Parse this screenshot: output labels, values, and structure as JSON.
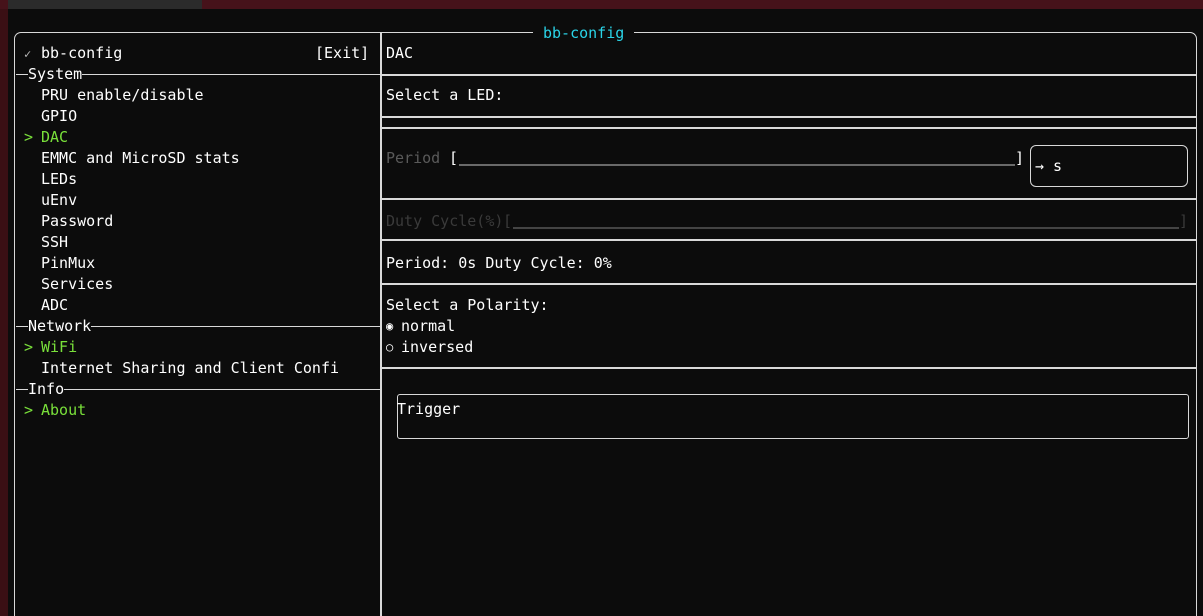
{
  "window": {
    "title": "bb-config"
  },
  "sidebar": {
    "header_check": "✓",
    "header_title": "bb-config",
    "exit_label": "[Exit]",
    "sections": [
      {
        "label": "System",
        "items": [
          "PRU enable/disable",
          "GPIO",
          "DAC",
          "EMMC and MicroSD stats",
          "LEDs",
          "uEnv",
          "Password",
          "SSH",
          "PinMux",
          "Services",
          "ADC"
        ]
      },
      {
        "label": "Network",
        "items": [
          "WiFi",
          "Internet Sharing and Client Confi"
        ]
      },
      {
        "label": "Info",
        "items": [
          "About"
        ]
      }
    ],
    "selected_marker": ">"
  },
  "main": {
    "title": "DAC",
    "led_prompt": "Select a LED:",
    "period": {
      "label": "Period",
      "bracket_open": "[",
      "bracket_close": "]",
      "value": "",
      "unit_arrow": "→ s"
    },
    "duty_cycle": {
      "label": "Duty Cycle(%)",
      "bracket_open": "[",
      "bracket_close": "]",
      "value": ""
    },
    "status": "Period: 0s Duty Cycle: 0%",
    "polarity_prompt": "Select a Polarity:",
    "polarity_options": [
      {
        "label": "normal",
        "marker": "◉",
        "selected": true
      },
      {
        "label": "inversed",
        "marker": "○",
        "selected": false
      }
    ],
    "trigger_label": "Trigger"
  },
  "colors": {
    "accent_green": "#79e03a",
    "title_cyan": "#2ad4e8",
    "border": "#d9d9d9",
    "background": "#0c0c0c"
  }
}
